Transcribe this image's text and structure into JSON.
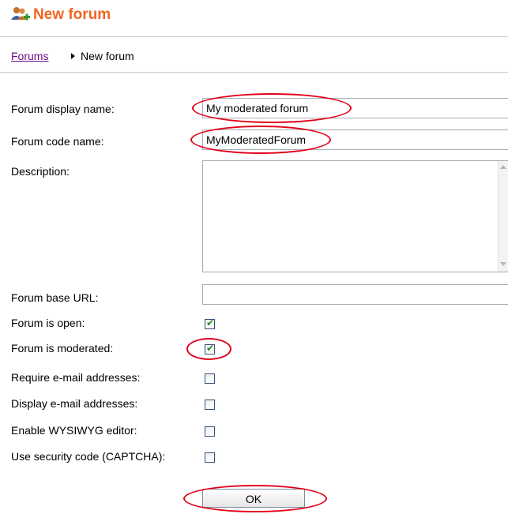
{
  "header": {
    "title": "New forum",
    "icon": "users-add-icon",
    "accent_color": "#f26522"
  },
  "breadcrumb": {
    "link_label": "Forums",
    "current_label": "New forum"
  },
  "form": {
    "display_name_label": "Forum display name:",
    "display_name_value": "My moderated forum",
    "code_name_label": "Forum code name:",
    "code_name_value": "MyModeratedForum",
    "description_label": "Description:",
    "description_value": "",
    "base_url_label": "Forum base URL:",
    "base_url_value": "",
    "is_open_label": "Forum is open:",
    "is_open_checked": true,
    "is_moderated_label": "Forum is moderated:",
    "is_moderated_checked": true,
    "require_email_label": "Require e-mail addresses:",
    "require_email_checked": false,
    "display_email_label": "Display e-mail addresses:",
    "display_email_checked": false,
    "wysiwyg_label": "Enable WYSIWYG editor:",
    "wysiwyg_checked": false,
    "captcha_label": "Use security code (CAPTCHA):",
    "captcha_checked": false,
    "ok_label": "OK"
  },
  "annotation_color": "#e2001a"
}
